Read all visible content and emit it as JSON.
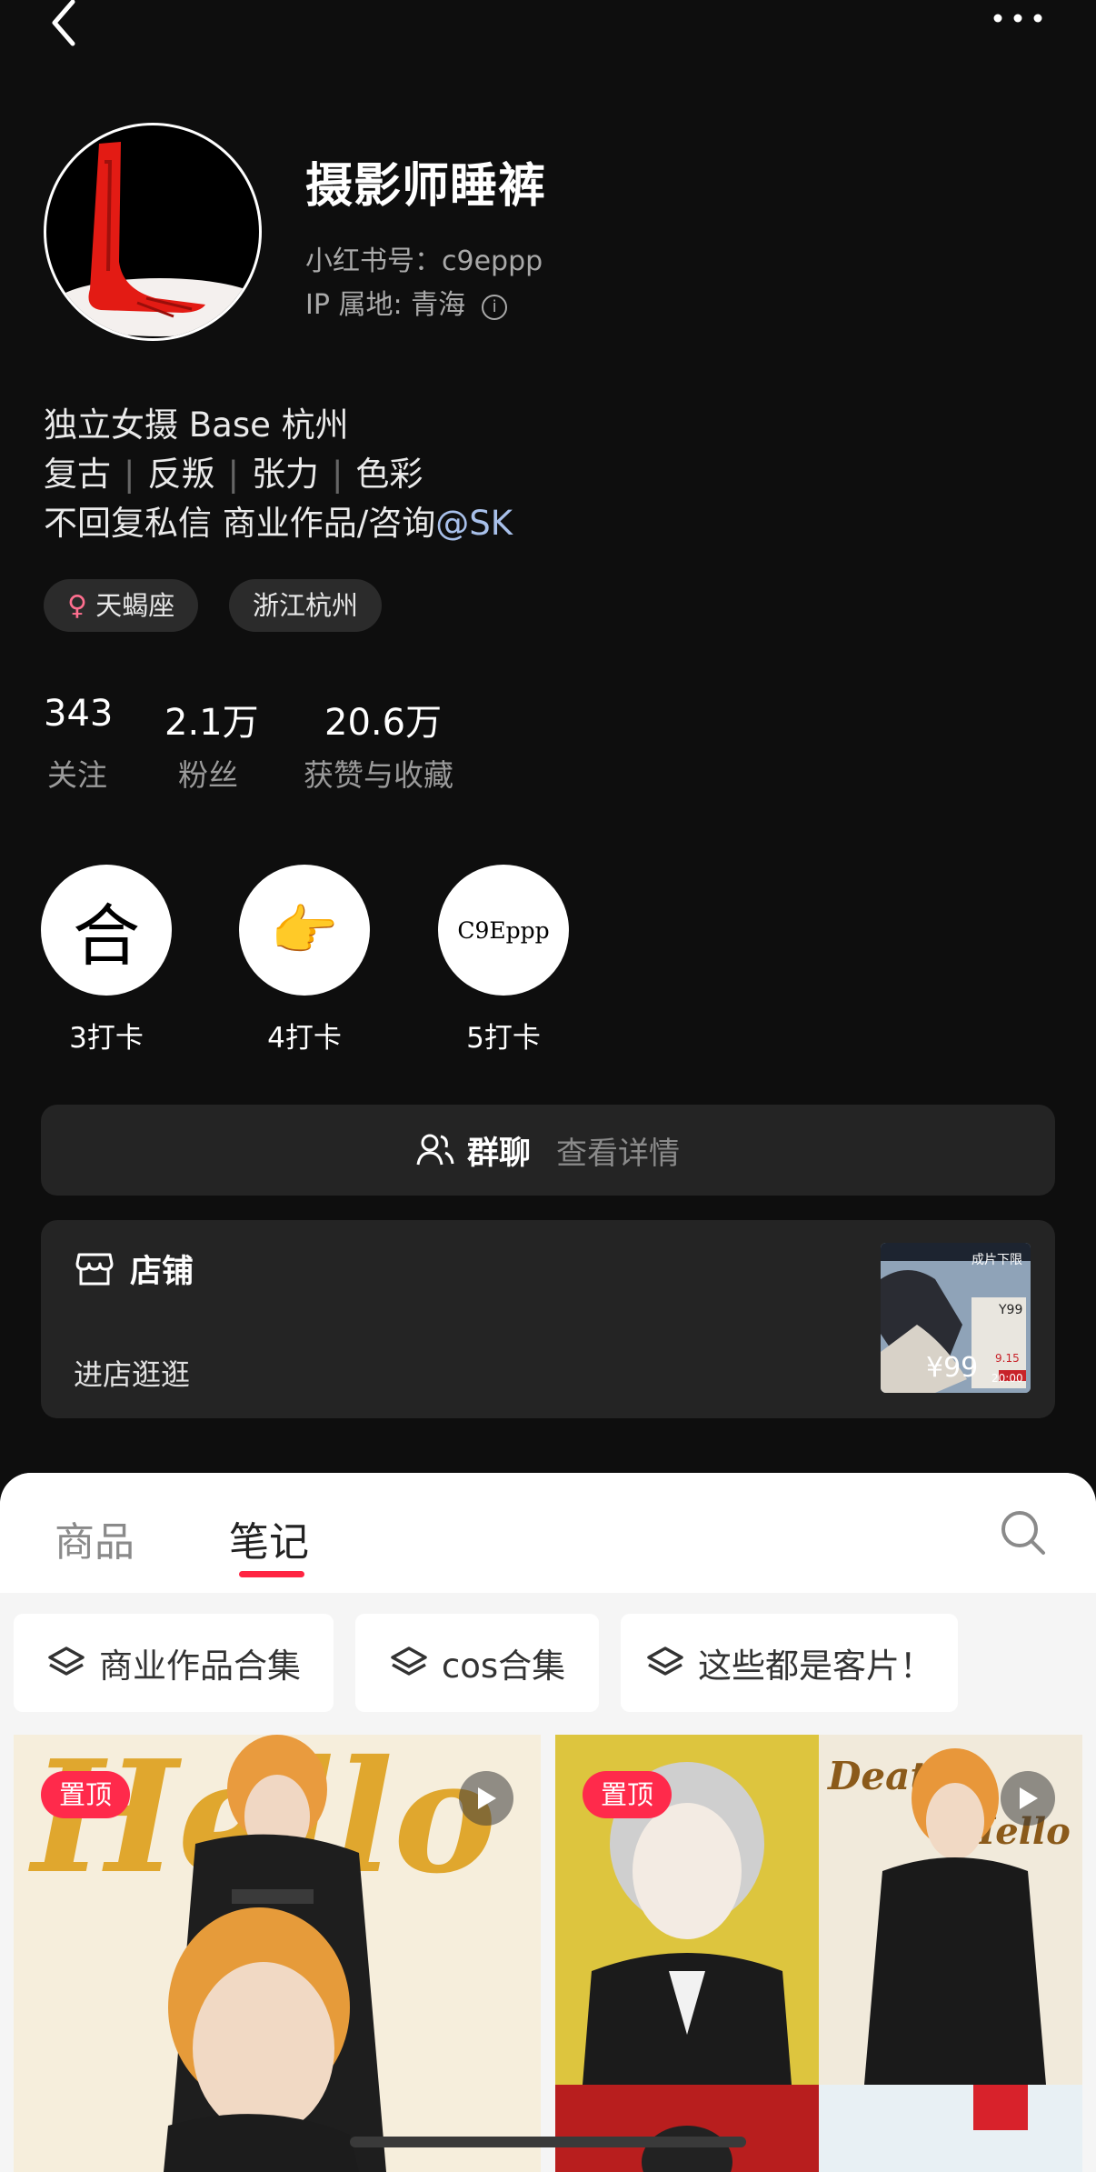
{
  "profile": {
    "name": "摄影师睡裤",
    "xhs_id": "小红书号：c9eppp",
    "ip_location": "IP 属地: 青海",
    "bio": {
      "line1": "独立女摄 Base 杭州",
      "line2": [
        "复古",
        "反叛",
        "张力",
        "色彩"
      ],
      "line3_prefix": "不回复私信 商业作品/咨询",
      "line3_mention": "@SK"
    },
    "tags": [
      {
        "label": "天蝎座",
        "icon": "female-icon"
      },
      {
        "label": "浙江杭州"
      }
    ],
    "stats": [
      {
        "value": "343",
        "label": "关注"
      },
      {
        "value": "2.1万",
        "label": "粉丝"
      },
      {
        "value": "20.6万",
        "label": "获赞与收藏"
      }
    ]
  },
  "badges": [
    {
      "icon_text": "合",
      "label": "3打卡"
    },
    {
      "icon": "pointing-hand-icon",
      "icon_text": "👉",
      "label": "4打卡"
    },
    {
      "icon_text": "C9Eppp",
      "label": "5打卡"
    }
  ],
  "group_chat": {
    "title": "群聊",
    "detail": "查看详情"
  },
  "shop": {
    "title": "店铺",
    "subtitle": "进店逛逛",
    "thumb_price": "¥99",
    "thumb_text": [
      "成片下限",
      "Y99",
      "9.15",
      "20:00"
    ]
  },
  "tabs": {
    "goods": "商品",
    "notes": "笔记",
    "active": "笔记"
  },
  "collections": [
    "商业作品合集",
    "cos合集",
    "这些都是客片！"
  ],
  "posts": [
    {
      "pinned_label": "置顶",
      "is_video": true
    },
    {
      "pinned_label": "置顶",
      "is_video": true,
      "overlay_text": "Death Mello"
    }
  ],
  "colors": {
    "accent": "#ff2442",
    "mention": "#a8c0ea",
    "bg": "#0e0e0e"
  }
}
